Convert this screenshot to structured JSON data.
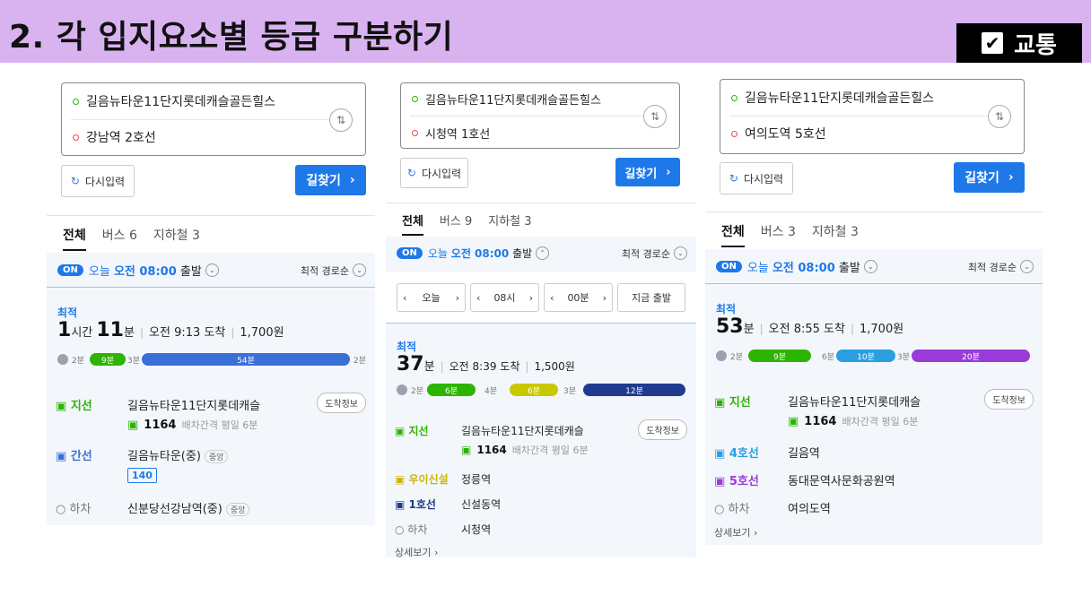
{
  "header": {
    "title": "2. 각 입지요소별 등급 구분하기",
    "tag": "교통",
    "tag_icon": "checkbox-icon"
  },
  "common": {
    "reset_label": "다시입력",
    "find_label": "길찾기",
    "on_label": "ON",
    "today_prefix": "오늘",
    "today_time": "오전 08:00",
    "depart": "출발",
    "sort_label": "최적 경로순",
    "best_label": "최적",
    "tab_all": "전체",
    "arrival_info": "도착정보",
    "bus_interval": "배차간격 평일 6분",
    "more_label": "상세보기",
    "alight_label": "하차",
    "origin": "길음뉴타운11단지롯데캐슬골든힐스"
  },
  "panel1": {
    "dest": "강남역 2호선",
    "tab_bus": "버스 6",
    "tab_subway": "지하철 3",
    "dur_h": "1",
    "dur_h_unit": "시간",
    "dur_m": "11",
    "dur_m_unit": "분",
    "arrive": "오전 9:13 도착",
    "fare": "1,700원",
    "bar": [
      "2분",
      "9분",
      "3분",
      "54분",
      "2분"
    ],
    "s1_type": "지선",
    "s1_name": "길음뉴타운11단지롯데캐슬",
    "s1_bus": "1164",
    "s2_type": "간선",
    "s2_name": "길음뉴타운(중)",
    "s2_badge": "중앙",
    "s2_bus": "140",
    "s3_name": "신분당선강남역(중)",
    "s3_badge": "중앙"
  },
  "panel2": {
    "dest": "시청역 1호선",
    "tab_bus": "버스 9",
    "tab_subway": "지하철 3",
    "picker": {
      "day": "오늘",
      "hour": "08시",
      "min": "00분",
      "now": "지금 출발"
    },
    "dur_m": "37",
    "dur_m_unit": "분",
    "arrive": "오전 8:39 도착",
    "fare": "1,500원",
    "bar": [
      "2분",
      "6분",
      "4분",
      "6분",
      "3분",
      "12분"
    ],
    "s1_type": "지선",
    "s1_name": "길음뉴타운11단지롯데캐슬",
    "s1_bus": "1164",
    "s2_type": "우이신설",
    "s2_name": "정릉역",
    "s3_type": "1호선",
    "s3_name": "신설동역",
    "s4_name": "시청역"
  },
  "panel3": {
    "dest": "여의도역 5호선",
    "tab_bus": "버스 3",
    "tab_subway": "지하철 3",
    "dur_m": "53",
    "dur_m_unit": "분",
    "arrive": "오전 8:55 도착",
    "fare": "1,700원",
    "bar": [
      "2분",
      "9분",
      "6분",
      "10분",
      "3분",
      "20분"
    ],
    "s1_type": "지선",
    "s1_name": "길음뉴타운11단지롯데캐슬",
    "s1_bus": "1164",
    "s2_type": "4호선",
    "s2_name": "길음역",
    "s3_type": "5호선",
    "s3_name": "동대문역사문화공원역",
    "s4_name": "여의도역"
  },
  "colors": {
    "accent": "#1f78e8",
    "bus_green": "#2db400",
    "bus_blue": "#3b6fd8",
    "line2": "#3b6fd8",
    "ui_sinseol": "#c8c800",
    "line1": "#1f3a8f",
    "line4": "#2a9fe0",
    "line5": "#9b3ad8",
    "header_bg": "#d9b3f0"
  }
}
